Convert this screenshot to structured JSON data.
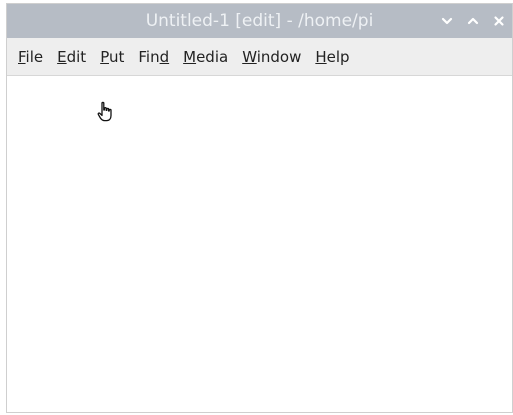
{
  "window": {
    "title": "Untitled-1  [edit] - /home/pi",
    "controls": {
      "minimize_icon": "chevron-down-icon",
      "maximize_icon": "chevron-up-icon",
      "close_icon": "close-icon"
    }
  },
  "menubar": {
    "items": [
      {
        "pre": "",
        "ul": "F",
        "post": "ile"
      },
      {
        "pre": "",
        "ul": "E",
        "post": "dit"
      },
      {
        "pre": "",
        "ul": "P",
        "post": "ut"
      },
      {
        "pre": "Fin",
        "ul": "d",
        "post": ""
      },
      {
        "pre": "",
        "ul": "M",
        "post": "edia"
      },
      {
        "pre": "",
        "ul": "W",
        "post": "indow"
      },
      {
        "pre": "",
        "ul": "H",
        "post": "elp"
      }
    ]
  },
  "editor": {
    "content": "",
    "pointer_icon": "hand-pointer-icon"
  },
  "colors": {
    "titlebar_bg": "#b6bcc5",
    "title_text": "#eef1f4",
    "menubar_bg": "#eeeeee"
  }
}
